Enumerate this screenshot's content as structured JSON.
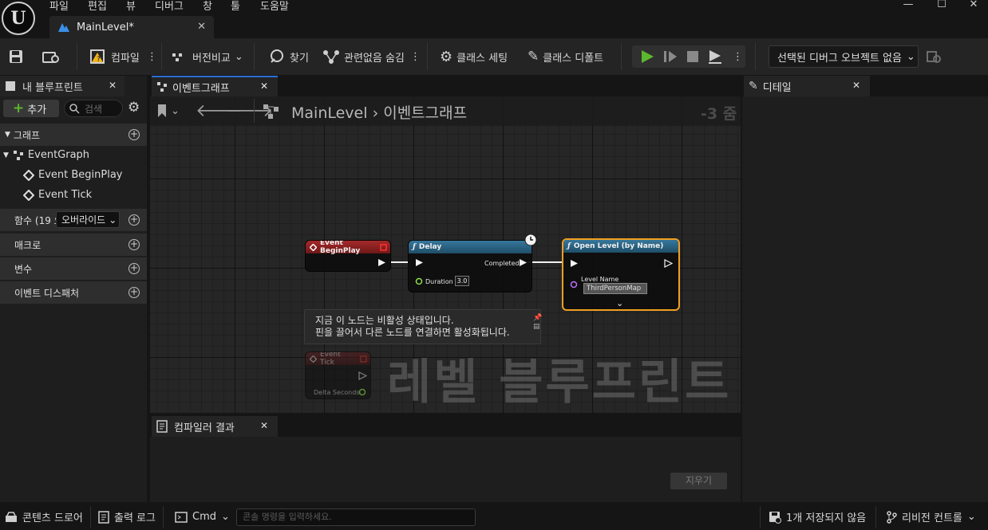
{
  "menu": [
    "파일",
    "편집",
    "뷰",
    "디버그",
    "창",
    "툴",
    "도움말"
  ],
  "window_controls": [
    "—",
    "☐",
    "✕"
  ],
  "doc_tab": {
    "label": "MainLevel*"
  },
  "toolbar": {
    "compile": "컴파일",
    "diff": "버전비교",
    "find": "찾기",
    "hide_unrelated": "관련없음 숨김",
    "class_settings": "클래스 세팅",
    "class_defaults": "클래스 디폴트",
    "debug_object": "선택된 디버그 오브젝트 없음"
  },
  "left_panel": {
    "tab": "내 블루프린트",
    "add": "추가",
    "search_placeholder": "검색",
    "sections": {
      "graph": "그래프",
      "functions": "함수 (19 오",
      "override": "오버라이드",
      "macros": "매크로",
      "variables": "변수",
      "dispatchers": "이벤트 디스패처"
    },
    "tree": {
      "event_graph": "EventGraph",
      "items": [
        "Event BeginPlay",
        "Event Tick"
      ]
    }
  },
  "graph": {
    "tab": "이벤트그래프",
    "breadcrumb": {
      "root": "MainLevel",
      "sep": "›",
      "current": "이벤트그래프"
    },
    "zoom": "-3 줌",
    "watermark": "레벨 블루프린트",
    "nodes": {
      "begin_play": "Event BeginPlay",
      "delay": {
        "title": "Delay",
        "completed": "Completed",
        "duration_label": "Duration",
        "duration_value": "3.0"
      },
      "open_level": {
        "title": "Open Level (by Name)",
        "level_name_label": "Level Name",
        "level_name_value": "ThirdPersonMap"
      },
      "event_tick": {
        "title": "Event Tick",
        "delta": "Delta Seconds"
      }
    },
    "tooltip": [
      "지금 이 노드는 비활성 상태입니다.",
      "핀을 끌어서 다른 노드를 연결하면 활성화됩니다."
    ]
  },
  "compiler": {
    "tab": "컴파일러 결과",
    "clear": "지우기"
  },
  "details": {
    "tab": "디테일"
  },
  "status_bar": {
    "content_drawer": "콘텐츠 드로어",
    "output_log": "출력 로그",
    "cmd": "Cmd",
    "cmd_placeholder": "콘솔 명령을 입력하세요.",
    "unsaved": "1개 저장되지 않음",
    "revision": "리비전 컨트롤"
  },
  "colors": {
    "accent": "#2b6fd6",
    "event_node": "#8a1f1f",
    "function_node": "#2a5f7f",
    "selection": "#f0a020",
    "play": "#5cb82e"
  }
}
